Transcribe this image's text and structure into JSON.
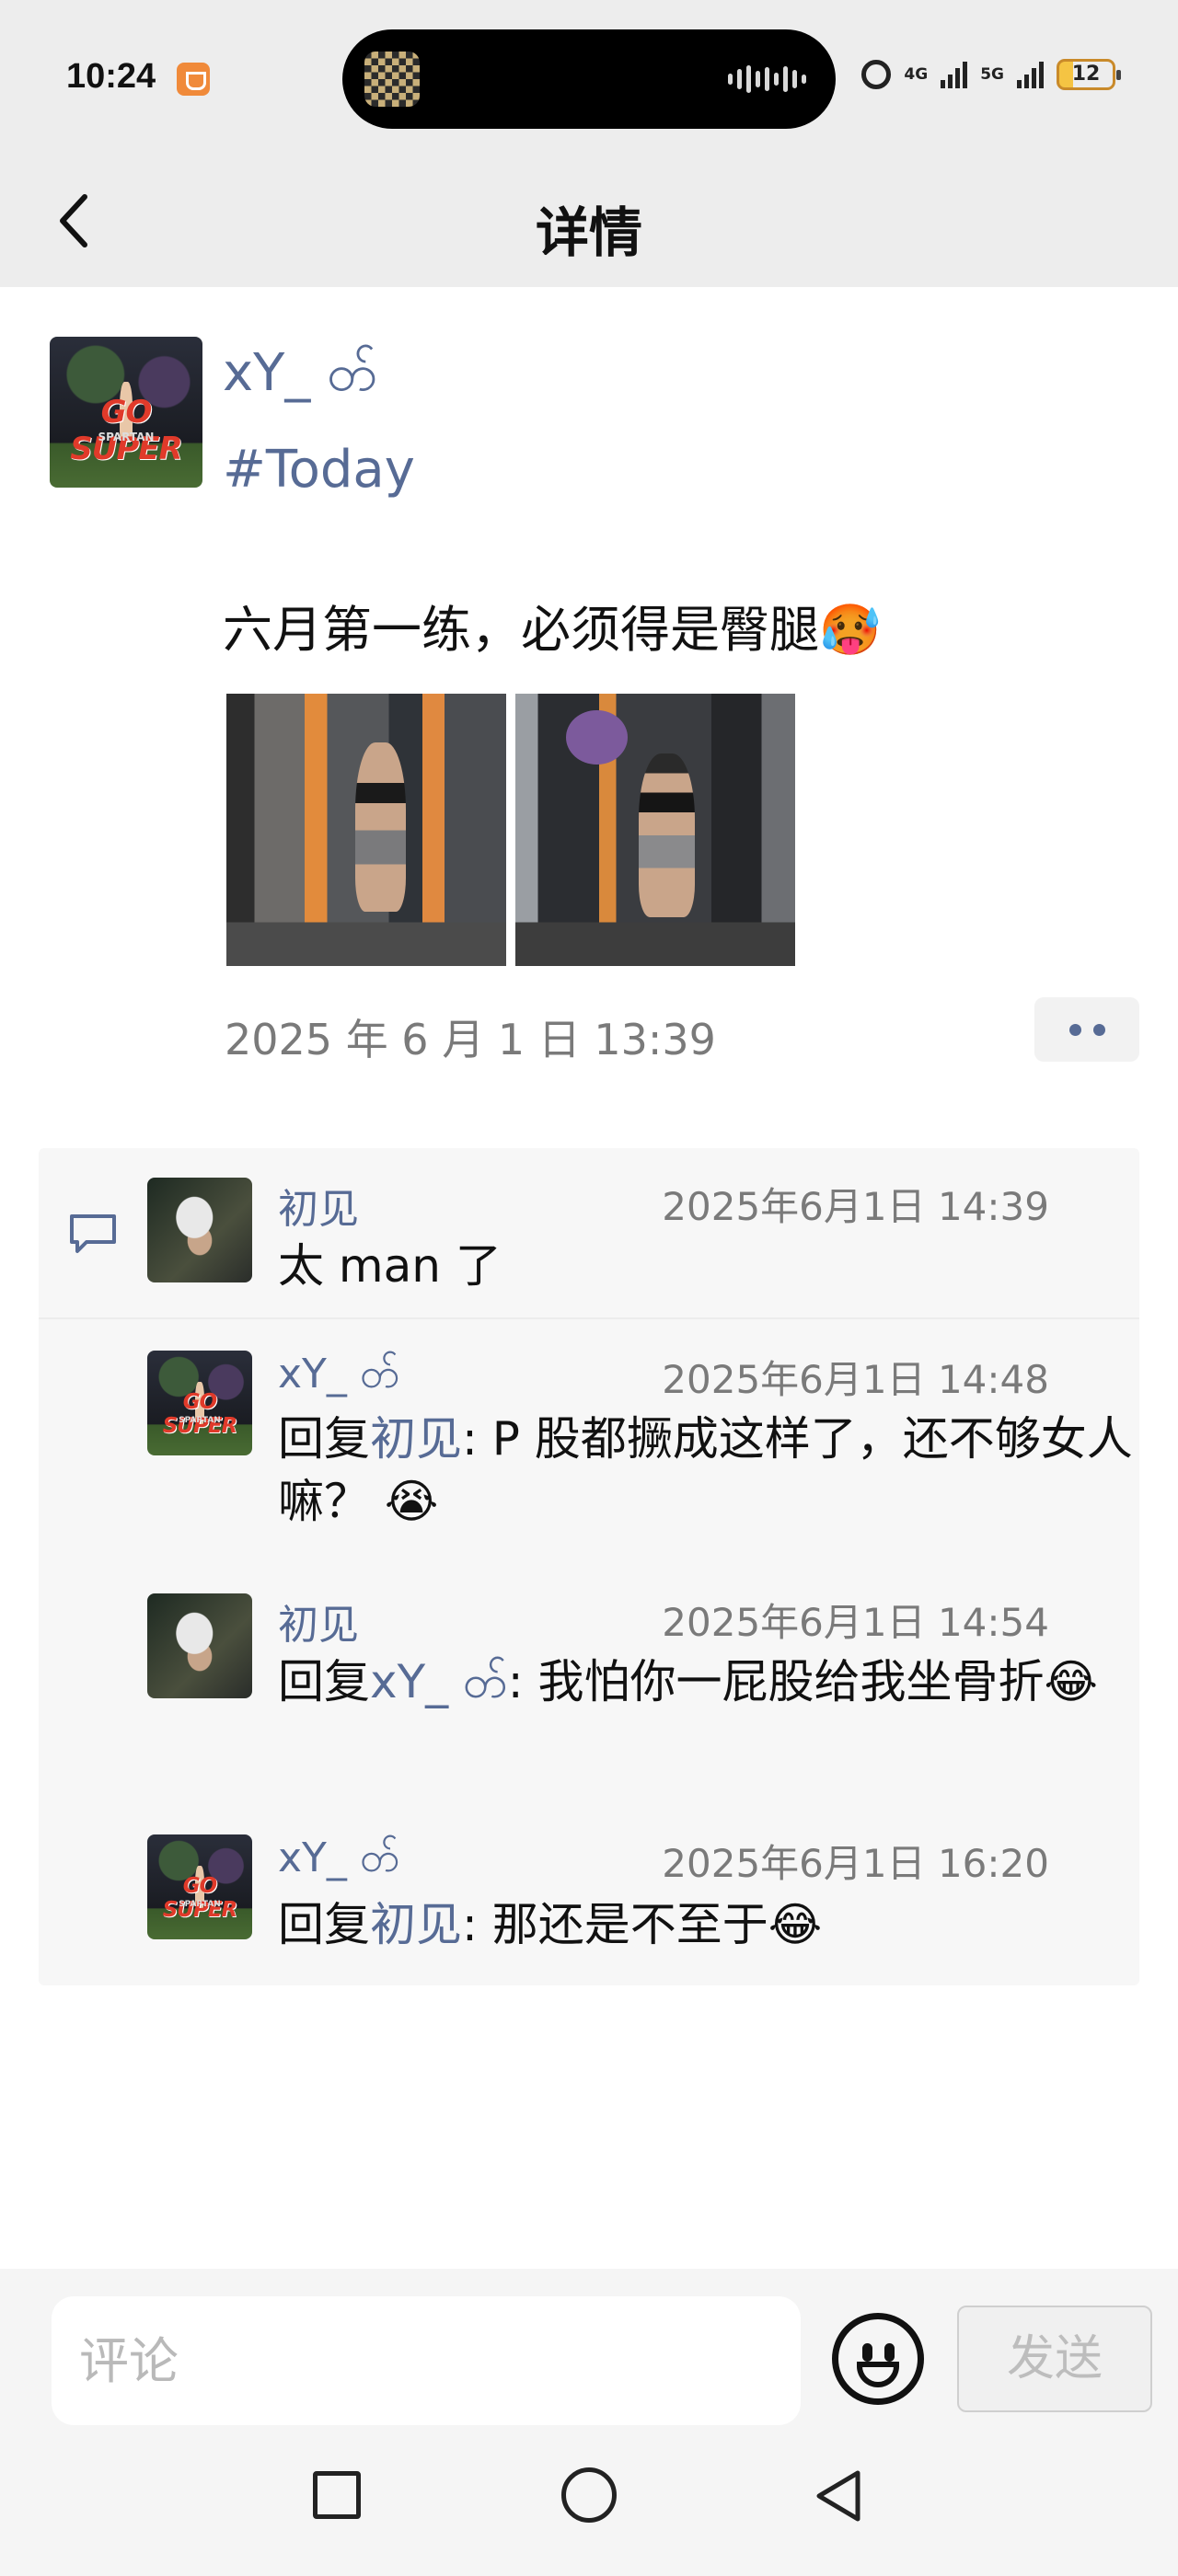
{
  "status_bar": {
    "time": "10:24",
    "network_1": "4G",
    "network_2": "5G",
    "battery": "12"
  },
  "nav": {
    "title": "详情",
    "back_icon": "chevron-left-icon"
  },
  "post": {
    "author": "xY_ တ်",
    "tag": "#Today",
    "text": "六月第一练，必须得是臀腿🥵",
    "image_count": 2,
    "time": "2025 年 6 月 1 日 13:39",
    "more_icon": "more-dots-icon"
  },
  "comments": [
    {
      "name": "初见",
      "time": "2025年6月1日 14:39",
      "text": "太 man 了",
      "avatar": "avatar-chu"
    },
    {
      "name": "xY_ တ်",
      "time": "2025年6月1日 14:48",
      "reply_prefix": "回复",
      "reply_to": "初见",
      "text": ": P 股都撅成这样了，还不够女人嘛？ 😭",
      "avatar": "avatar-go"
    },
    {
      "name": "初见",
      "time": "2025年6月1日 14:54",
      "reply_prefix": "回复",
      "reply_to": "xY_ တ်",
      "text": ": 我怕你一屁股给我坐骨折😂",
      "avatar": "avatar-chu"
    },
    {
      "name": "xY_ တ်",
      "time": "2025年6月1日 16:20",
      "reply_prefix": "回复",
      "reply_to": "初见",
      "text": ": 那还是不至于😂",
      "avatar": "avatar-go"
    }
  ],
  "composer": {
    "placeholder": "评论",
    "send_label": "发送"
  },
  "colors": {
    "link": "#576b95",
    "bar_bg": "#ededed",
    "comment_bg": "#f7f7f7"
  }
}
